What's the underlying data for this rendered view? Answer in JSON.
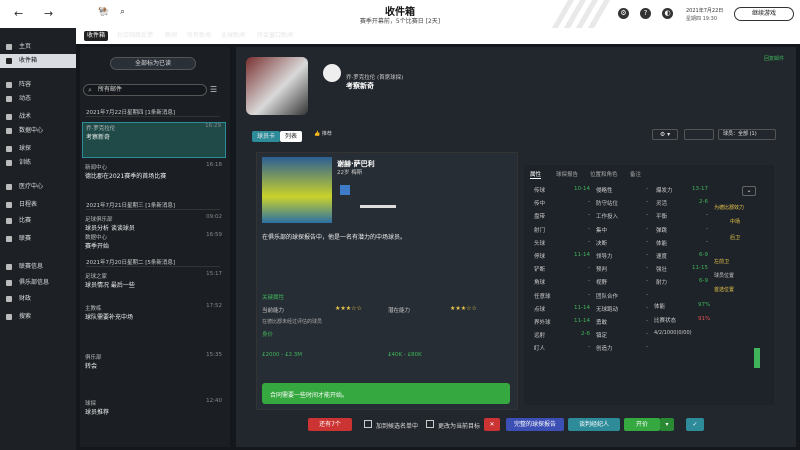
{
  "topbar": {
    "title": "收件箱",
    "subtitle": "赛季开幕前，5个比赛日 [2天]",
    "continue": "继续游戏",
    "date": "2021年7月22日",
    "time": "星期四 19:30"
  },
  "sidebar": {
    "items": [
      "主页",
      "收件箱",
      "阵容",
      "动态",
      "战术",
      "数据中心",
      "球探",
      "训练",
      "医疗中心",
      "日程表",
      "比赛",
      "联赛",
      "联赛信息",
      "俱乐部信息",
      "财政",
      "搜索"
    ]
  },
  "tabs": [
    "收件箱",
    "社交网络反馈",
    "新闻",
    "所有新闻",
    "全球新闻",
    "转会窗口新闻"
  ],
  "inbox": {
    "mark_all": "全部标为已读",
    "search": "所有邮件",
    "groups": [
      "2021年7月22日星期四 [1条新消息]",
      "2021年7月21日星期三 [1条新消息]",
      "2021年7月20日星期二 [5条新消息]"
    ],
    "messages": [
      {
        "from": "乔·罗克拉伦",
        "subject": "考察新奇",
        "time": "16:29"
      },
      {
        "from": "新闻中心",
        "subject": "德比郡在2021赛季的首场比赛",
        "time": "16:18"
      },
      {
        "from": "足球俱乐部",
        "subject": "球员分析 谈谈球员",
        "time": "09:02"
      },
      {
        "from": "数据中心",
        "subject": "赛季开始",
        "time": "16:59"
      },
      {
        "from": "足球之家",
        "subject": "球员情况 最后一些",
        "time": "15:17"
      },
      {
        "from": "主教练",
        "subject": "球队需要补充中场",
        "time": "17:52"
      },
      {
        "from": "俱乐部",
        "subject": "转会",
        "time": "15:35"
      },
      {
        "from": "球探",
        "subject": "球员推荐",
        "time": "12:40"
      }
    ]
  },
  "message": {
    "sender": "乔·罗克拉伦 (首席球探)",
    "subject": "考察新奇",
    "action": "回复邮件",
    "subtabs": [
      "球员卡",
      "列表"
    ],
    "filter": "球员：全部 (1)"
  },
  "player": {
    "name": "谢赫·萨巴利",
    "club": "22岁 梅斯",
    "comment": "在俱乐部的球探报告中，他是一名有潜力的中场球员。",
    "section_title": "关键属性",
    "rating_label": "当前能力",
    "potential_label": "潜在能力",
    "ability_stars": "★★★☆☆",
    "potential_stars": "★★★☆☆",
    "value_title": "身价",
    "value_range": "£2000 - £2.3M",
    "wage": "£40K - £80K",
    "status": "在德比郡未经过评估的球员"
  },
  "attr_tabs": [
    "属性",
    "球探报告",
    "位置和角色",
    "备注"
  ],
  "attrs": [
    {
      "k": "传球",
      "v": "10-14"
    },
    {
      "k": "传中",
      "v": "-"
    },
    {
      "k": "盘带",
      "v": "-"
    },
    {
      "k": "射门",
      "v": "-"
    },
    {
      "k": "头球",
      "v": "-"
    },
    {
      "k": "停球",
      "v": "11-14"
    },
    {
      "k": "铲断",
      "v": "-"
    },
    {
      "k": "角球",
      "v": "-"
    },
    {
      "k": "任意球",
      "v": "-"
    },
    {
      "k": "点球",
      "v": "11-14"
    },
    {
      "k": "界外球",
      "v": "11-14"
    },
    {
      "k": "远射",
      "v": "2-6"
    },
    {
      "k": "盯人",
      "v": "-"
    }
  ],
  "attrs2": [
    {
      "k": "侵略性",
      "v": "-"
    },
    {
      "k": "防守站位",
      "v": "-"
    },
    {
      "k": "工作投入",
      "v": "-"
    },
    {
      "k": "集中",
      "v": "-"
    },
    {
      "k": "决断",
      "v": "-"
    },
    {
      "k": "领导力",
      "v": "-"
    },
    {
      "k": "预判",
      "v": "-"
    },
    {
      "k": "视野",
      "v": "-"
    },
    {
      "k": "团队合作",
      "v": "-"
    },
    {
      "k": "无球跑动",
      "v": "-"
    },
    {
      "k": "勇敢",
      "v": "-"
    },
    {
      "k": "镇定",
      "v": "-"
    },
    {
      "k": "创造力",
      "v": "-"
    }
  ],
  "attrs3": [
    {
      "k": "爆发力",
      "v": "13-17"
    },
    {
      "k": "灵活",
      "v": "2-6"
    },
    {
      "k": "平衡",
      "v": "-"
    },
    {
      "k": "弹跳",
      "v": "-"
    },
    {
      "k": "体能",
      "v": "-"
    },
    {
      "k": "速度",
      "v": "6-9"
    },
    {
      "k": "强壮",
      "v": "11-15"
    },
    {
      "k": "耐力",
      "v": "6-9"
    }
  ],
  "side": {
    "role": "为德比郡效力",
    "pos1": "中场",
    "pos2": "后卫",
    "pos3": "左前卫",
    "fit": "体能",
    "fit_pct": "97%",
    "morale": "比赛状态",
    "morale_pct": "91%",
    "matches": "4/2/1000(0/00)",
    "label1": "球员位置",
    "label2": "首选位置"
  },
  "footer": {
    "btn1": "还有7个",
    "btn2": "加到候选名单中",
    "btn3": "更改为当前目标",
    "btn4": "完整的球探报告",
    "btn5": "谈判经纪人",
    "btn6": "开价",
    "btn7": "✓"
  },
  "notice": "合同需要一些时间才能开始。"
}
